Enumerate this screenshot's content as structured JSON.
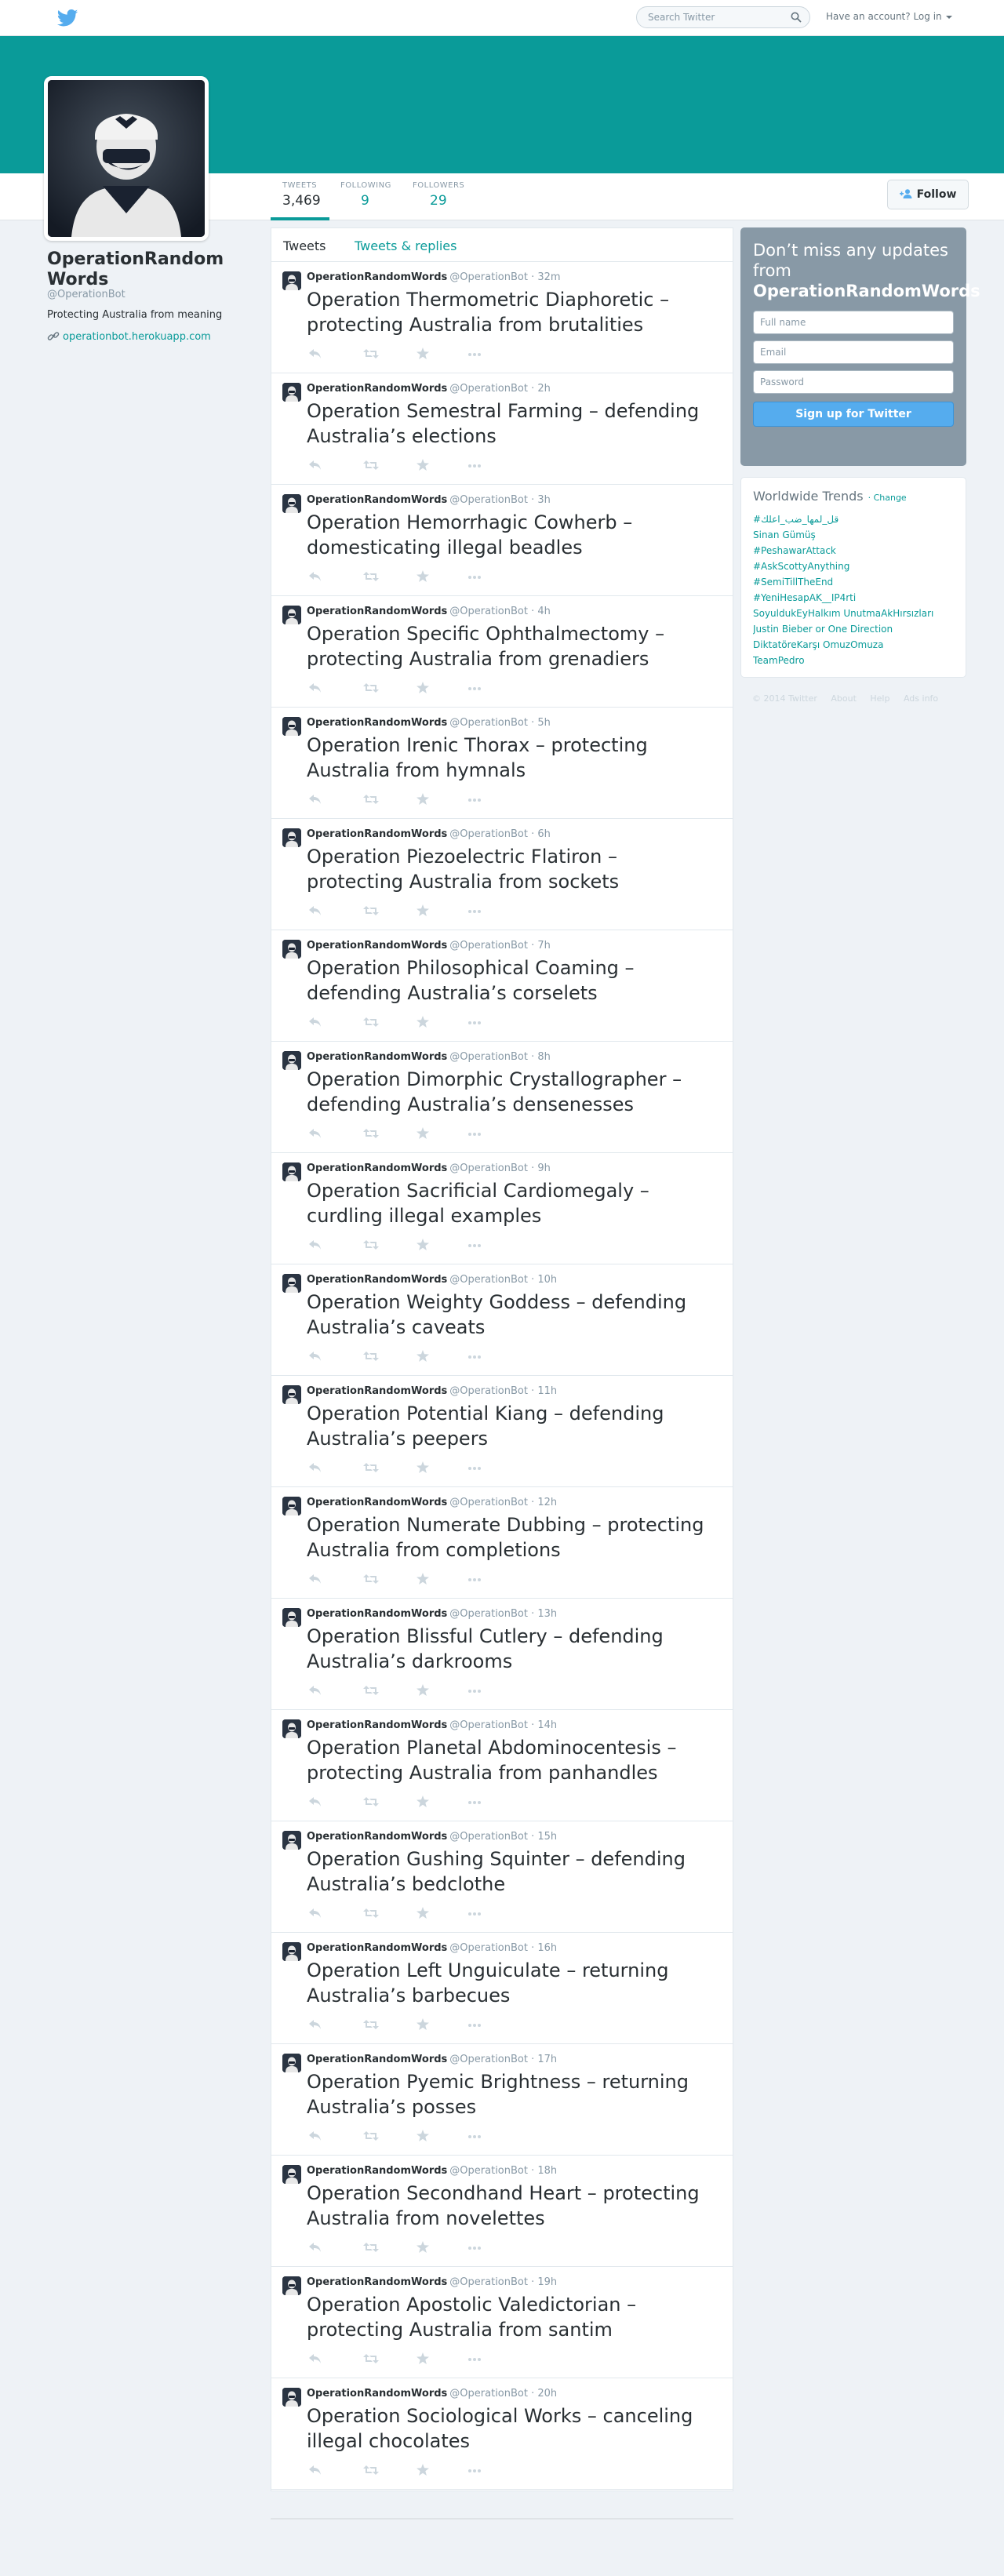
{
  "topbar": {
    "search_placeholder": "Search Twitter",
    "login_label": "Have an account? Log in"
  },
  "profile": {
    "name": "OperationRandomWords",
    "handle": "@OperationBot",
    "bio": "Protecting Australia from meaning",
    "url": "operationbot.herokuapp.com",
    "follow_label": "Follow",
    "stats": {
      "tweets_label": "TWEETS",
      "tweets": "3,469",
      "following_label": "FOLLOWING",
      "following": "9",
      "followers_label": "FOLLOWERS",
      "followers": "29"
    }
  },
  "timeline": {
    "tab_tweets": "Tweets",
    "tab_replies": "Tweets & replies",
    "author_name": "OperationRandomWords",
    "author_handle": "@OperationBot",
    "tweets": [
      {
        "time": "· 32m",
        "text": "Operation Thermometric Diaphoretic – protecting Australia from brutalities"
      },
      {
        "time": "· 2h",
        "text": "Operation Semestral Farming – defending Australia’s elections"
      },
      {
        "time": "· 3h",
        "text": "Operation Hemorrhagic Cowherb – domesticating illegal beadles"
      },
      {
        "time": "· 4h",
        "text": "Operation Specific Ophthalmectomy – protecting Australia from grenadiers"
      },
      {
        "time": "· 5h",
        "text": "Operation Irenic Thorax – protecting Australia from hymnals"
      },
      {
        "time": "· 6h",
        "text": "Operation Piezoelectric Flatiron – protecting Australia from sockets"
      },
      {
        "time": "· 7h",
        "text": "Operation Philosophical Coaming – defending Australia’s corselets"
      },
      {
        "time": "· 8h",
        "text": "Operation Dimorphic Crystallographer – defending Australia’s densenesses"
      },
      {
        "time": "· 9h",
        "text": "Operation Sacrificial Cardiomegaly – curdling illegal examples"
      },
      {
        "time": "· 10h",
        "text": "Operation Weighty Goddess – defending Australia’s caveats"
      },
      {
        "time": "· 11h",
        "text": "Operation Potential Kiang – defending Australia’s peepers"
      },
      {
        "time": "· 12h",
        "text": "Operation Numerate Dubbing – protecting Australia from completions"
      },
      {
        "time": "· 13h",
        "text": "Operation Blissful Cutlery – defending Australia’s darkrooms"
      },
      {
        "time": "· 14h",
        "text": "Operation Planetal Abdominocentesis – protecting Australia from panhandles"
      },
      {
        "time": "· 15h",
        "text": "Operation Gushing Squinter – defending Australia’s bedclothe"
      },
      {
        "time": "· 16h",
        "text": "Operation Left Unguiculate – returning Australia’s barbecues"
      },
      {
        "time": "· 17h",
        "text": "Operation Pyemic Brightness – returning Australia’s posses"
      },
      {
        "time": "· 18h",
        "text": "Operation Secondhand Heart – protecting Australia from novelettes"
      },
      {
        "time": "· 19h",
        "text": "Operation Apostolic Valedictorian – protecting Australia from santim"
      },
      {
        "time": "· 20h",
        "text": "Operation Sociological Works – canceling illegal chocolates"
      }
    ]
  },
  "signup": {
    "heading": "Don’t miss any updates from",
    "heading_name": "OperationRandomWords",
    "fullname_placeholder": "Full name",
    "email_placeholder": "Email",
    "password_placeholder": "Password",
    "button_label": "Sign up for Twitter"
  },
  "trends": {
    "title": "Worldwide Trends",
    "change_label": "· Change",
    "items": [
      "#قل_لمها_ضب_اعلك",
      "Sinan Gümüş",
      "#PeshawarAttack",
      "#AskScottyAnything",
      "#SemiTillTheEnd",
      "#YeniHesapAK__IP4rti",
      "SoyuldukEyHalkım UnutmaAkHırsızları",
      "Justin Bieber or One Direction",
      "DiktatöreKarşı OmuzOmuza",
      "TeamPedro"
    ]
  },
  "footer": {
    "copyright": "© 2014 Twitter",
    "about": "About",
    "help": "Help",
    "ads": "Ads info"
  },
  "colors": {
    "accent": "#0a9b99",
    "banner": "#0a9b99",
    "signup_bg": "#8899a6",
    "signup_button": "#55acee",
    "twitter_blue": "#55acee"
  }
}
